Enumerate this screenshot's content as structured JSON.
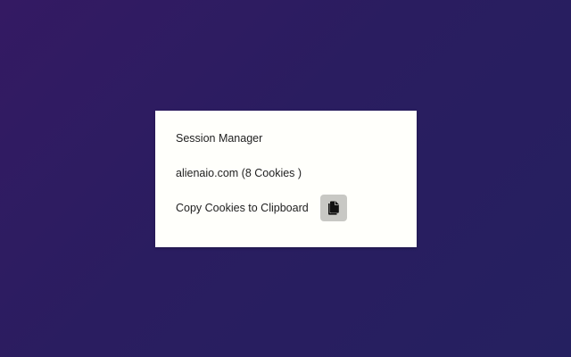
{
  "popup": {
    "title": "Session Manager",
    "domain": "alienaio.com",
    "cookie_count_text": "(8 Cookies )",
    "copy_label": "Copy Cookies to Clipboard",
    "copy_icon": "copy-icon"
  },
  "colors": {
    "background_start": "#341a63",
    "background_end": "#252060",
    "popup_bg": "#fffffb",
    "button_bg": "#c8c8c4",
    "text": "#1f1f1f"
  }
}
